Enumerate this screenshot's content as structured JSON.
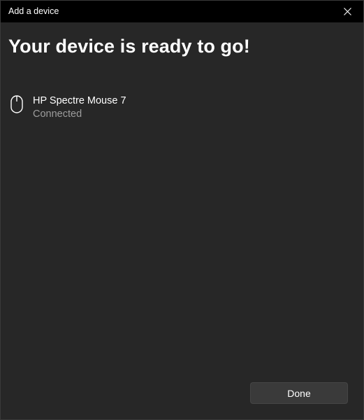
{
  "window": {
    "title": "Add a device",
    "close_icon": "close-icon"
  },
  "main": {
    "heading": "Your device is ready to go!",
    "device": {
      "icon": "mouse-icon",
      "name": "HP Spectre Mouse 7",
      "status": "Connected"
    }
  },
  "footer": {
    "done_label": "Done"
  },
  "colors": {
    "titlebar_bg": "#000000",
    "window_bg": "#272727",
    "button_bg": "#3a3a3a",
    "secondary_text": "#9d9d9d"
  }
}
